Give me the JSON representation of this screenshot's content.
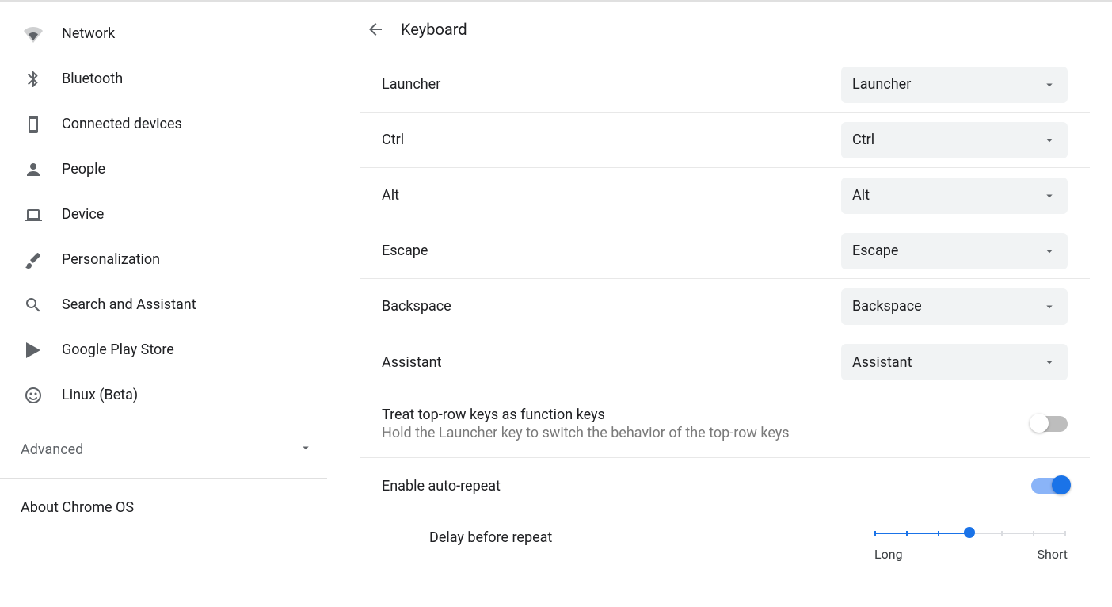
{
  "sidebar": {
    "items": [
      {
        "label": "Network",
        "icon": "wifi-icon"
      },
      {
        "label": "Bluetooth",
        "icon": "bluetooth-icon"
      },
      {
        "label": "Connected devices",
        "icon": "phone-icon"
      },
      {
        "label": "People",
        "icon": "person-icon"
      },
      {
        "label": "Device",
        "icon": "laptop-icon"
      },
      {
        "label": "Personalization",
        "icon": "brush-icon"
      },
      {
        "label": "Search and Assistant",
        "icon": "search-icon"
      },
      {
        "label": "Google Play Store",
        "icon": "play-icon"
      },
      {
        "label": "Linux (Beta)",
        "icon": "linux-icon"
      }
    ],
    "advanced_label": "Advanced",
    "about_label": "About Chrome OS"
  },
  "header": {
    "title": "Keyboard"
  },
  "key_rows": [
    {
      "label": "Launcher",
      "value": "Launcher"
    },
    {
      "label": "Ctrl",
      "value": "Ctrl"
    },
    {
      "label": "Alt",
      "value": "Alt"
    },
    {
      "label": "Escape",
      "value": "Escape"
    },
    {
      "label": "Backspace",
      "value": "Backspace"
    },
    {
      "label": "Assistant",
      "value": "Assistant"
    }
  ],
  "function_keys": {
    "label": "Treat top-row keys as function keys",
    "sublabel": "Hold the Launcher key to switch the behavior of the top-row keys",
    "enabled": false
  },
  "auto_repeat": {
    "label": "Enable auto-repeat",
    "enabled": true
  },
  "delay": {
    "label": "Delay before repeat",
    "min_label": "Long",
    "max_label": "Short",
    "value": 0.5
  }
}
